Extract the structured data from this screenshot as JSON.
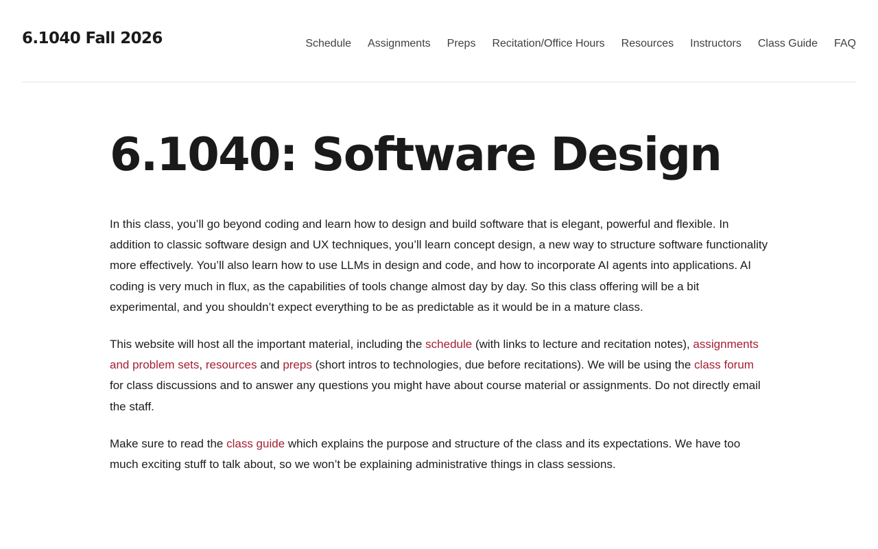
{
  "header": {
    "site_title": "6.1040 Fall 2026",
    "nav": [
      "Schedule",
      "Assignments",
      "Preps",
      "Recitation/Office Hours",
      "Resources",
      "Instructors",
      "Class Guide",
      "FAQ"
    ]
  },
  "main": {
    "title": "6.1040: Software Design",
    "intro": "In this class, you’ll go beyond coding and learn how to design and build software that is elegant, powerful and flexible. In addition to classic software design and UX techniques, you’ll learn concept design, a new way to structure software functionality more effectively. You’ll also learn how to use LLMs in design and code, and how to incorporate AI agents into applications. AI coding is very much in flux, as the capabilities of tools change almost day by day. So this class offering will be a bit experimental, and you shouldn’t expect everything to be as predictable as it would be in a mature class.",
    "site_info": {
      "t1": "This website will host all the important material, including the ",
      "link_schedule": "schedule",
      "t2": " (with links to lecture and recitation notes), ",
      "link_assignments": "assignments and problem sets",
      "t3": ", ",
      "link_resources": "resources",
      "t4": " and ",
      "link_preps": "preps",
      "t5": " (short intros to technologies, due before recitations). We will be using the ",
      "link_forum": "class forum",
      "t6": " for class discussions and to answer any questions you might have about course material or assignments. Do not directly email the staff."
    },
    "guide": {
      "t1": "Make sure to read the ",
      "link_guide": "class guide",
      "t2": " which explains the purpose and structure of the class and its expectations. We have too much exciting stuff to talk about, so we won’t be explaining administrative things in class sessions."
    }
  },
  "colors": {
    "link": "#a31f34",
    "text": "#1c1c1c",
    "nav_text": "#3f3f3f",
    "divider": "#e2e2e2"
  }
}
